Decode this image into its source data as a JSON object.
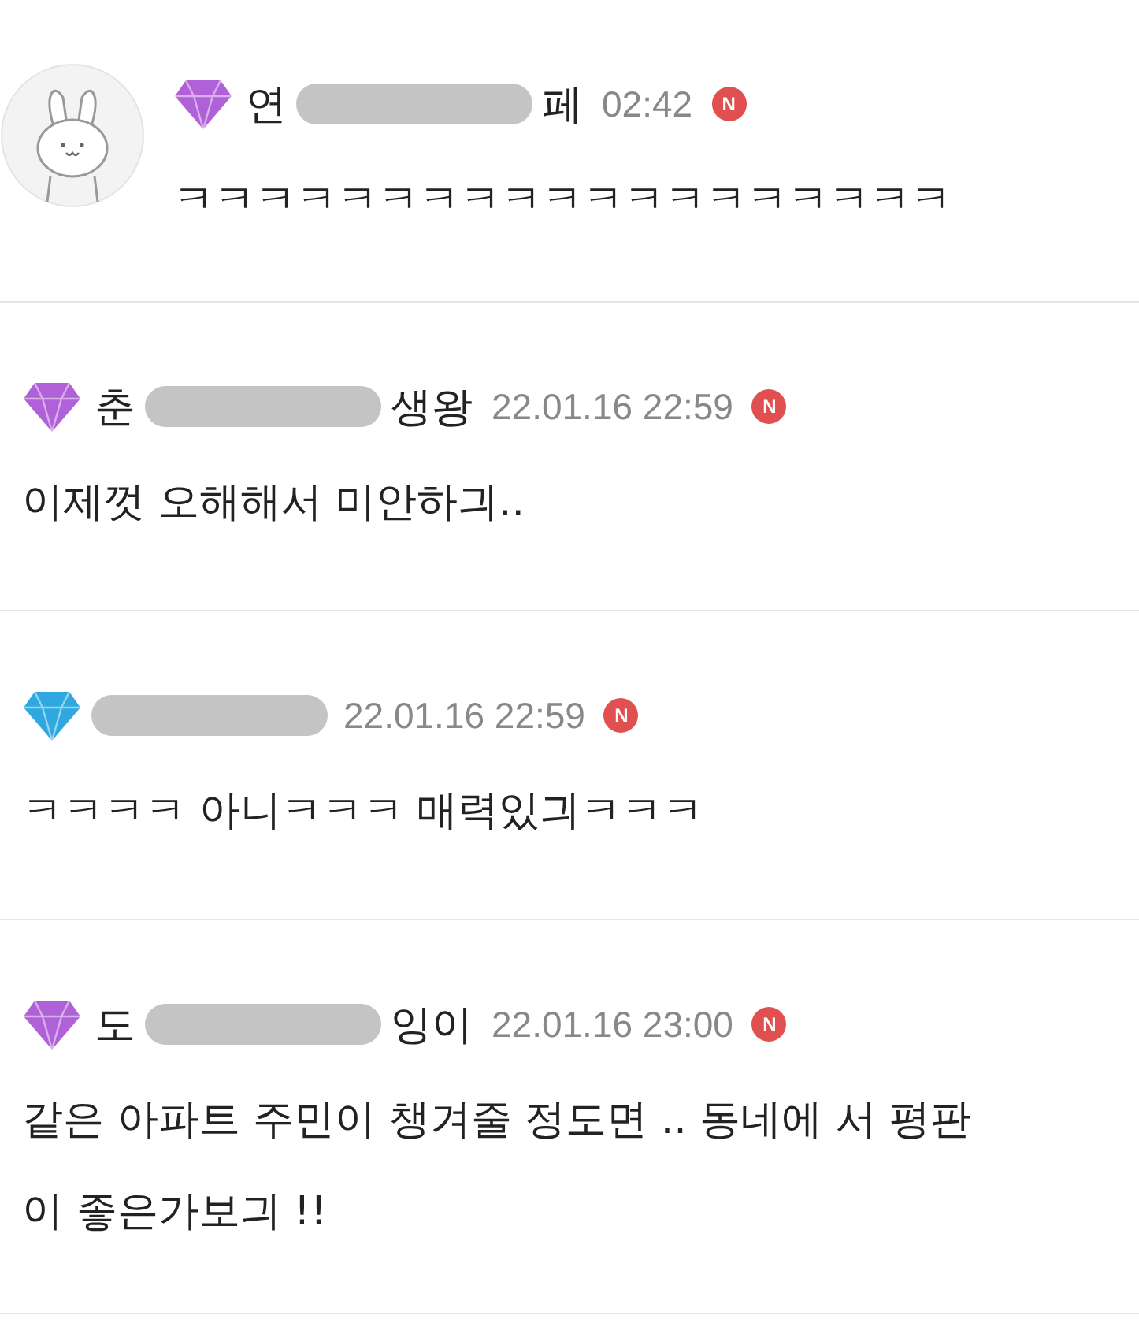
{
  "comments": [
    {
      "avatar": true,
      "color": "#b061d8",
      "name_start": "연",
      "name_end": "페",
      "time": "02:42",
      "badge": "N",
      "text": "ㅋㅋㅋㅋㅋㅋㅋㅋㅋㅋㅋㅋㅋㅋㅋㅋㅋㅋㅋ"
    },
    {
      "avatar": false,
      "color": "#b061d8",
      "name_start": "춘",
      "name_end": "생왕",
      "time": "22.01.16 22:59",
      "badge": "N",
      "text": "이제껏 오해해서 미안하긔.."
    },
    {
      "avatar": false,
      "color": "#2fa8e0",
      "time": "22.01.16 22:59",
      "badge": "N",
      "text": "ㅋㅋㅋㅋ 아니ㅋㅋㅋ 매력있긔ㅋㅋㅋ"
    },
    {
      "avatar": false,
      "color": "#b061d8",
      "name_start": "도",
      "name_end": "잉이",
      "time": "22.01.16 23:00",
      "badge": "N",
      "text": "같은 아파트 주민이 챙겨줄 정도면 .. 동네에 서 평판이 좋은가보긔 !!"
    }
  ]
}
